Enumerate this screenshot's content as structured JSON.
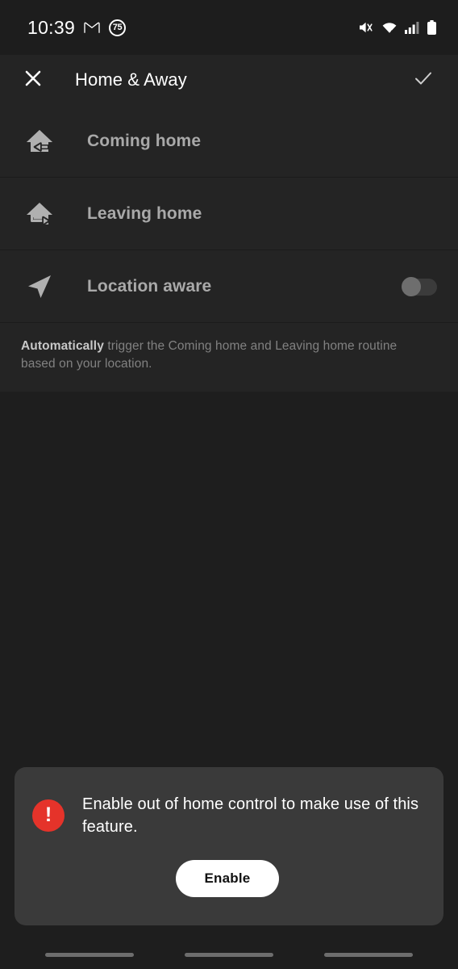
{
  "status_bar": {
    "time": "10:39",
    "gmail_icon": "gmail-icon",
    "notification_badge": "75",
    "mute_icon": "volume-mute-icon",
    "wifi_icon": "wifi-icon",
    "signal_icon": "cellular-signal-icon",
    "battery_icon": "battery-icon"
  },
  "header": {
    "close_icon": "close-icon",
    "title": "Home & Away",
    "confirm_icon": "check-icon"
  },
  "rows": [
    {
      "label": "Coming home",
      "icon": "house-arrow-in-icon",
      "has_toggle": false
    },
    {
      "label": "Leaving home",
      "icon": "house-arrow-out-icon",
      "has_toggle": false
    },
    {
      "label": "Location aware",
      "icon": "navigation-arrow-icon",
      "has_toggle": true,
      "toggle_state": "off"
    }
  ],
  "description": {
    "strong": "Automatically",
    "rest": " trigger the Coming home and Leaving home routine based on your location."
  },
  "alert_card": {
    "icon": "alert-exclamation-icon",
    "message": "Enable out of home control to make use of this feature.",
    "button_label": "Enable"
  },
  "nav_bar": {
    "pills": 3
  },
  "colors": {
    "page_background": "#1e1e1e",
    "row_background": "#242424",
    "card_background": "#3a3a3a",
    "alert_red": "#e5332a",
    "label_grey": "#a9a9a9",
    "description_grey": "#818181",
    "accent_white": "#ffffff"
  }
}
